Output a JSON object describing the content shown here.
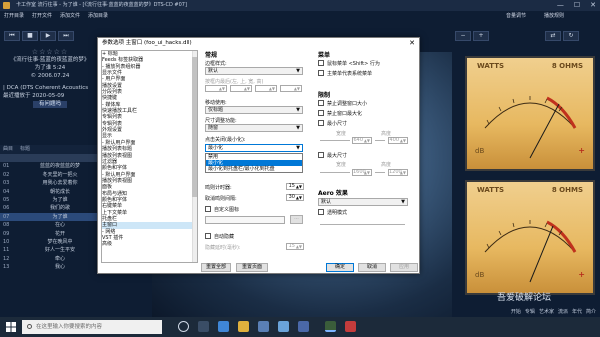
{
  "player": {
    "title": "卡工作室  流行往事 - 为了谁 - [《流行往事·蓝蓝的夜蓝蓝的梦》DTS-CD #07]",
    "menu": [
      "打开目录",
      "打开文件",
      "添加文件",
      "添加目录"
    ],
    "menu_right": [
      "音量调节",
      "播放规则"
    ],
    "info": {
      "stars": "☆☆☆☆☆",
      "lines": [
        "《流行往事·蓝蓝的夜蓝蓝的梦》",
        "为了谁  5:24",
        "© 2006.07.24"
      ],
      "dts": "| DCA (DTS Coherent Acoustics",
      "date": "最近播放于 2020-05-09",
      "tag": "有问题吗"
    },
    "playlist": {
      "headers": [
        "曲目",
        "标题"
      ],
      "rows": [
        {
          "num": "01",
          "title": "蓝蓝的夜蓝蓝的梦"
        },
        {
          "num": "02",
          "title": "冬天里的一把火"
        },
        {
          "num": "03",
          "title": "用我心去爱着你"
        },
        {
          "num": "04",
          "title": "朝花成长"
        },
        {
          "num": "05",
          "title": "为了谁"
        },
        {
          "num": "06",
          "title": "我们的歌"
        },
        {
          "num": "07",
          "title": "为了谁"
        },
        {
          "num": "08",
          "title": "在心"
        },
        {
          "num": "09",
          "title": "花开"
        },
        {
          "num": "10",
          "title": "梦在晚风中"
        },
        {
          "num": "11",
          "title": "好人一生平安"
        },
        {
          "num": "12",
          "title": "牵心"
        },
        {
          "num": "13",
          "title": "我心"
        }
      ]
    },
    "vu": [
      {
        "brand": "WATTS",
        "ohm": "8 OHMS"
      },
      {
        "brand": "WATTS",
        "ohm": "8 OHMS"
      }
    ],
    "footer": [
      "开始",
      "专辑",
      "艺术家",
      "流派",
      "年代",
      "简介"
    ],
    "watermark": "吾爱破解论坛"
  },
  "dialog": {
    "title": "参数选项 主窗口 (foo_ui_hacks.dll)",
    "tree": [
      {
        "label": "        + 标题",
        "level": 0
      },
      {
        "label": "        Feeds 标签获取器",
        "level": 1
      },
      {
        "label": "    - 播放列表组织器",
        "level": 0
      },
      {
        "label": "          显示文件",
        "level": 1
      },
      {
        "label": "    - 用户界面",
        "level": 0
      },
      {
        "label": "          播放设置",
        "level": 1
      },
      {
        "label": "    分段列表",
        "level": 0
      },
      {
        "label": "    快捷键",
        "level": 0
      },
      {
        "label": "  - 媒体库",
        "level": 0
      },
      {
        "label": "        快速播放工具栏",
        "level": 1
      },
      {
        "label": "        专辑列表",
        "level": 1
      },
      {
        "label": "        专辑列表",
        "level": 1
      },
      {
        "label": "    外观设置",
        "level": 0
      },
      {
        "label": "    显示",
        "level": 0
      },
      {
        "label": "  - 默认用户界面",
        "level": 0
      },
      {
        "label": "        播放列表标题",
        "level": 1
      },
      {
        "label": "        播放列表视图",
        "level": 1
      },
      {
        "label": "        过滤器",
        "level": 1
      },
      {
        "label": "        颜色和字体",
        "level": 1
      },
      {
        "label": "  - 默认用户界面",
        "level": 0
      },
      {
        "label": "        播放列表视图",
        "level": 1
      },
      {
        "label": "        面板",
        "level": 1
      },
      {
        "label": "        布局与通知",
        "level": 1
      },
      {
        "label": "        颜色和字体",
        "level": 1
      },
      {
        "label": "        右键菜单",
        "level": 1
      },
      {
        "label": "    上下文菜单",
        "level": 0
      },
      {
        "label": "    托盘栏",
        "level": 0
      },
      {
        "label": "    主窗口",
        "level": 0
      },
      {
        "label": "  - 网络",
        "level": 0
      },
      {
        "label": "        VST 插件",
        "level": 1
      },
      {
        "label": "    高级",
        "level": 0
      }
    ],
    "left": {
      "section": "常规",
      "framestyle_label": "边框样式:",
      "framestyle_value": "默认",
      "frame_sub": "按框内最后(左, 上, 宽, 高)",
      "move_label": "移动使用:",
      "move_value": "仅标题",
      "resize_label": "尺寸调整功能:",
      "resize_value": "随窗",
      "minimize_label": "点击关闭(最小化):",
      "minimize_value": "最小化",
      "dropdown_options": [
        "禁用",
        "最小化",
        "最小化到托盘栏/最小化到托盘"
      ],
      "timer_label": "鸣则计时器:",
      "timer_value": "15",
      "ms_label": "取消鸣则间隔:",
      "ms_value": "30",
      "custom_icon": "自定义图标",
      "auto_hide": "自动隐藏",
      "hide_delay_label": "隐藏延时(毫秒):",
      "hide_delay_value": "15"
    },
    "right": {
      "section": "菜单",
      "cb1": "鼠标菜单 <Shift> 行为",
      "cb2": "主菜单代表系统菜单",
      "limits_section": "限制",
      "cb3": "禁止调整窗口大小",
      "cb4": "禁止窗口最大化",
      "min_size": "最小尺寸",
      "width_label": "宽度",
      "height_label": "高度",
      "min_w": "640",
      "min_h": "400",
      "max_size": "最大尺寸",
      "max_w": "1600",
      "max_h": "1200",
      "aero_section": "Aero 效果",
      "aero_value": "默认",
      "transparent": "透明模式"
    },
    "buttons": {
      "reset_all": "重置全部",
      "reset_page": "重置页面",
      "ok": "确定",
      "cancel": "取消",
      "apply": "应用"
    }
  },
  "taskbar": {
    "search_placeholder": "在这里输入你要搜索的内容"
  }
}
